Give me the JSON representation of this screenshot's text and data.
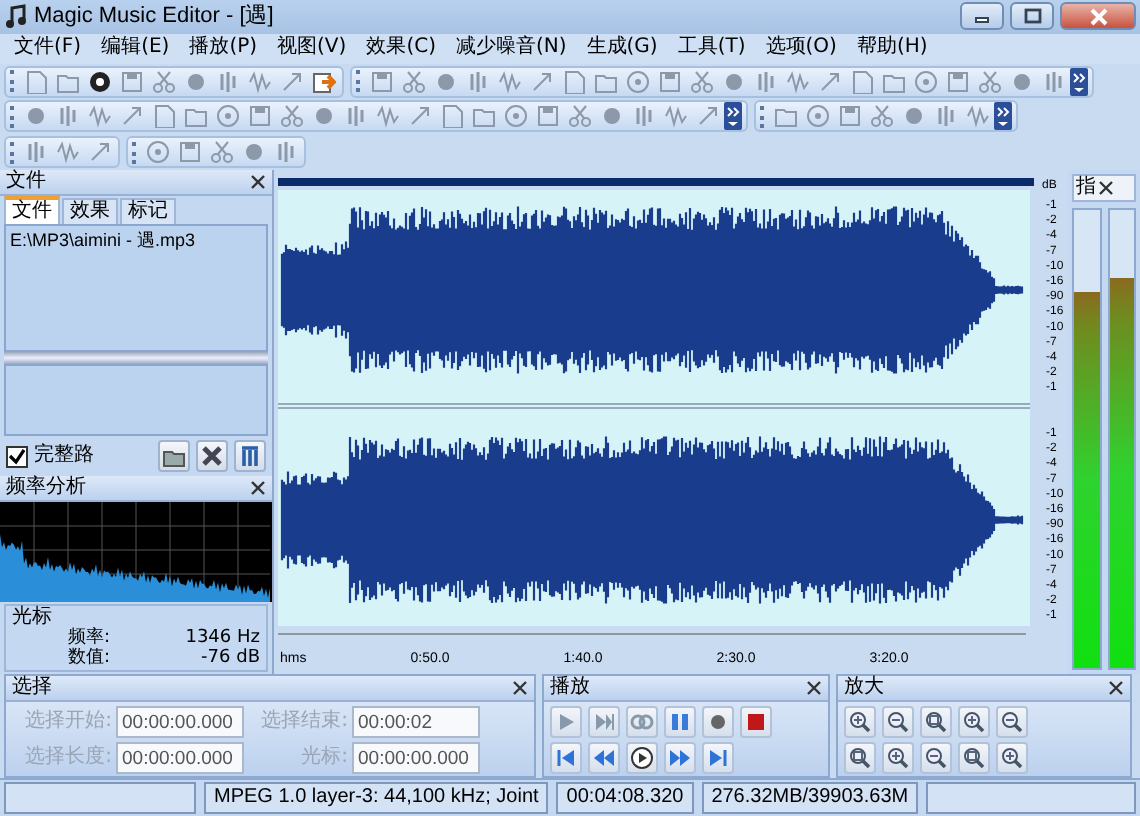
{
  "window": {
    "title": "Magic Music Editor - [遇]"
  },
  "menu": [
    "文件(F)",
    "编辑(E)",
    "播放(P)",
    "视图(V)",
    "效果(C)",
    "减少噪音(N)",
    "生成(G)",
    "工具(T)",
    "选项(O)",
    "帮助(H)"
  ],
  "file_panel": {
    "title": "文件",
    "tabs": [
      {
        "label": "文件",
        "selected": true
      },
      {
        "label": "效果",
        "selected": false
      },
      {
        "label": "标记",
        "selected": false
      }
    ],
    "files": [
      "E:\\MP3\\aimini - 遇.mp3"
    ],
    "full_path": {
      "label": "完整路",
      "checked": true
    }
  },
  "spectrum_panel": {
    "title": "频率分析",
    "cursor": {
      "title": "光标",
      "rows": [
        {
          "label": "频率:",
          "value": "1346 Hz"
        },
        {
          "label": "数值:",
          "value": "-76 dB"
        }
      ]
    }
  },
  "waveform": {
    "db_unit": "dB",
    "db_labels": [
      [
        "-1",
        "-2",
        "-4",
        "-7",
        "-10",
        "-16",
        "-90",
        "-16",
        "-10",
        "-7",
        "-4",
        "-2",
        "-1"
      ],
      [
        "-1",
        "-2",
        "-4",
        "-7",
        "-10",
        "-16",
        "-90",
        "-16",
        "-10",
        "-7",
        "-4",
        "-2",
        "-1"
      ]
    ],
    "time_unit": "hms",
    "time_labels": [
      "0:50.0",
      "1:40.0",
      "2:30.0",
      "3:20.0"
    ]
  },
  "meter": {
    "title": "指",
    "channels": [
      {
        "level": 0.82
      },
      {
        "level": 0.85
      }
    ]
  },
  "selection_panel": {
    "title": "选择",
    "fields": [
      {
        "label": "选择开始:",
        "value": "00:00:00.000",
        "disabled": true
      },
      {
        "label": "选择结束:",
        "value": "00:00:02",
        "disabled": true
      },
      {
        "label": "选择长度:",
        "value": "00:00:00.000",
        "disabled": true
      },
      {
        "label": "光标:",
        "value": "00:00:00.000",
        "disabled": true
      }
    ]
  },
  "playback_panel": {
    "title": "播放"
  },
  "zoom_panel": {
    "title": "放大"
  },
  "status_bar": {
    "format": "MPEG 1.0 layer-3: 44,100 kHz; Joint",
    "duration": "00:04:08.320",
    "memory": "276.32MB/39903.63M"
  }
}
